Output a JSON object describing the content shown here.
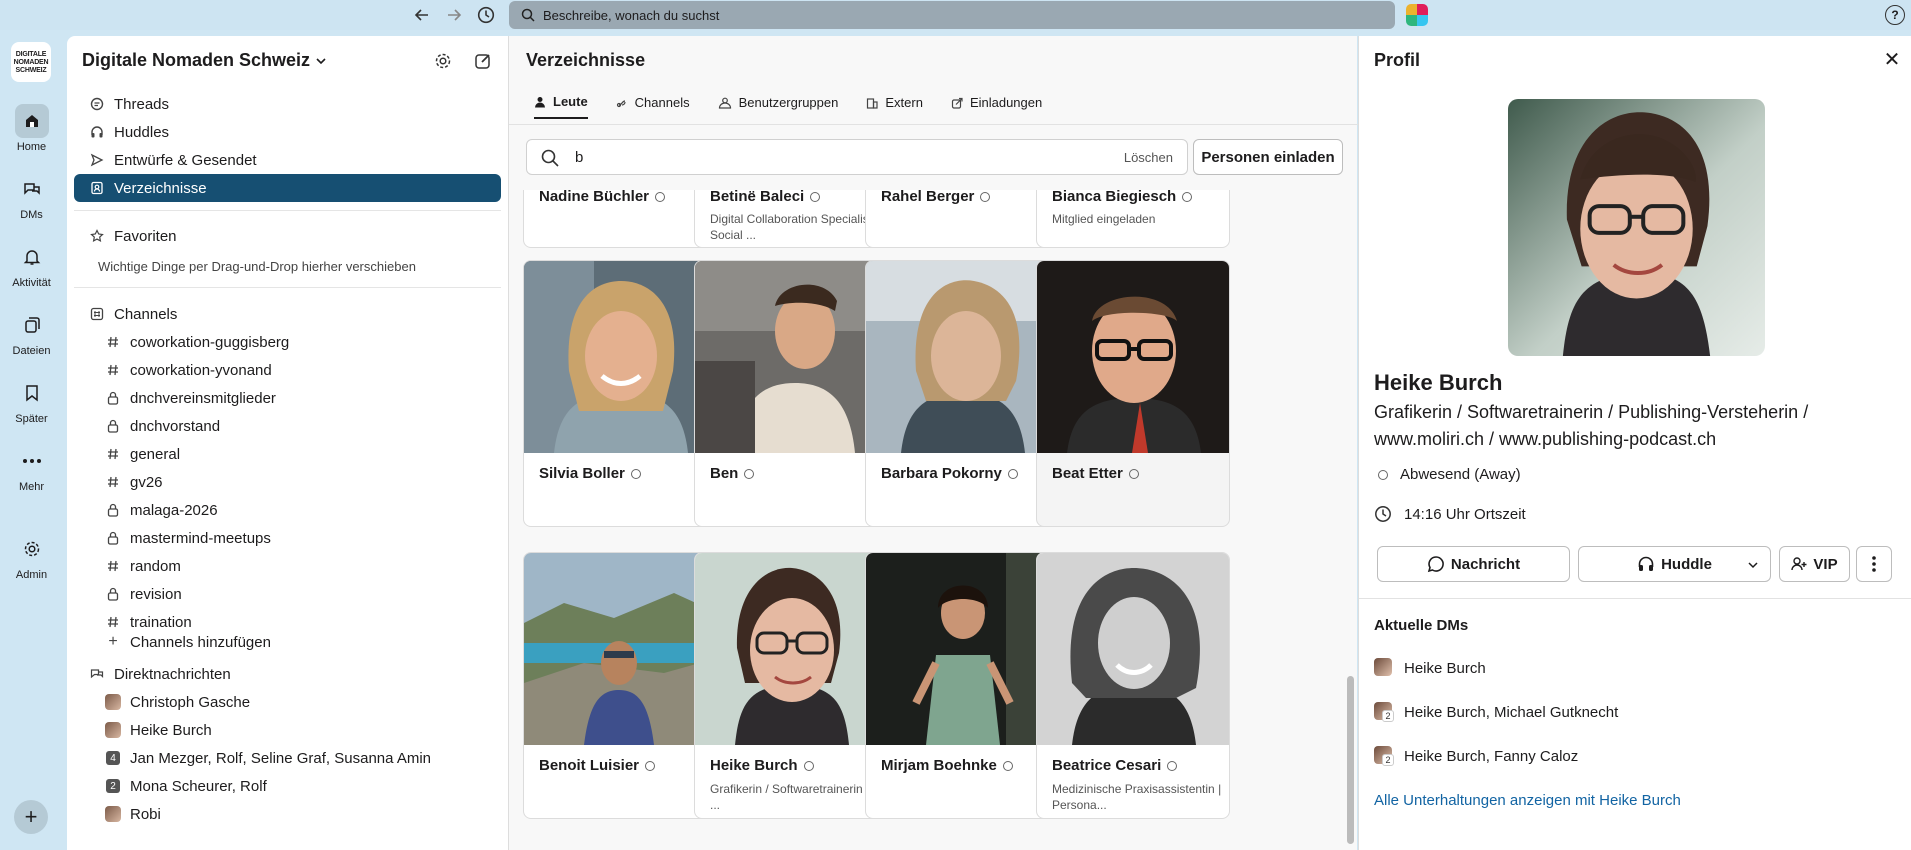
{
  "topbar": {
    "search_placeholder": "Beschreibe, wonach du suchst",
    "help": "?"
  },
  "rail": {
    "logo_lines": [
      "DIGITALE",
      "NOMADEN",
      "SCHWEIZ"
    ],
    "items": [
      {
        "label": "Home",
        "icon": "home-icon"
      },
      {
        "label": "DMs",
        "icon": "dms-icon"
      },
      {
        "label": "Aktivität",
        "icon": "bell-icon"
      },
      {
        "label": "Dateien",
        "icon": "files-icon"
      },
      {
        "label": "Später",
        "icon": "bookmark-icon"
      },
      {
        "label": "Mehr",
        "icon": "more-icon"
      },
      {
        "label": "Admin",
        "icon": "gear-icon"
      }
    ],
    "add": "+"
  },
  "sidebar": {
    "workspace": "Digitale Nomaden Schweiz",
    "nav": [
      {
        "label": "Threads",
        "icon": "threads-icon"
      },
      {
        "label": "Huddles",
        "icon": "headphones-icon"
      },
      {
        "label": "Entwürfe & Gesendet",
        "icon": "send-icon"
      },
      {
        "label": "Verzeichnisse",
        "icon": "directory-icon"
      }
    ],
    "favorites": {
      "label": "Favoriten",
      "hint": "Wichtige Dinge per Drag-und-Drop hierher verschieben"
    },
    "channels_label": "Channels",
    "channels": [
      {
        "name": "coworkation-guggisberg",
        "private": false
      },
      {
        "name": "coworkation-yvonand",
        "private": false
      },
      {
        "name": "dnchvereinsmitglieder",
        "private": true
      },
      {
        "name": "dnchvorstand",
        "private": true
      },
      {
        "name": "general",
        "private": false
      },
      {
        "name": "gv26",
        "private": false
      },
      {
        "name": "malaga-2026",
        "private": true
      },
      {
        "name": "mastermind-meetups",
        "private": true
      },
      {
        "name": "random",
        "private": false
      },
      {
        "name": "revision",
        "private": true
      },
      {
        "name": "traination",
        "private": false
      }
    ],
    "add_channel": "Channels hinzufügen",
    "dm_label": "Direktnachrichten",
    "dms": [
      {
        "name": "Christoph Gasche",
        "badge": ""
      },
      {
        "name": "Heike Burch",
        "badge": ""
      },
      {
        "name": "Jan Mezger, Rolf, Seline Graf, Susanna Amin",
        "badge": "4"
      },
      {
        "name": "Mona Scheurer, Rolf",
        "badge": "2"
      },
      {
        "name": "Robi",
        "badge": ""
      }
    ]
  },
  "main": {
    "title": "Verzeichnisse",
    "tabs": [
      {
        "label": "Leute",
        "icon": "person-icon"
      },
      {
        "label": "Channels",
        "icon": "channels-icon"
      },
      {
        "label": "Benutzergruppen",
        "icon": "group-icon"
      },
      {
        "label": "Extern",
        "icon": "building-icon"
      },
      {
        "label": "Einladungen",
        "icon": "invite-icon"
      }
    ],
    "search_value": "b",
    "clear_label": "Löschen",
    "invite_label": "Personen einladen",
    "top_cards": [
      {
        "name": "Nadine Büchler",
        "sub": ""
      },
      {
        "name": "Betinë Baleci",
        "sub": "Digital Collaboration Specialist | Social ..."
      },
      {
        "name": "Rahel Berger",
        "sub": ""
      },
      {
        "name": "Bianca Biegiesch",
        "sub": "Mitglied eingeladen"
      }
    ],
    "cards": [
      {
        "name": "Silvia Boller",
        "sub": ""
      },
      {
        "name": "Ben",
        "sub": ""
      },
      {
        "name": "Barbara Pokorny",
        "sub": ""
      },
      {
        "name": "Beat Etter",
        "sub": ""
      },
      {
        "name": "Benoit Luisier",
        "sub": ""
      },
      {
        "name": "Heike Burch",
        "sub": "Grafikerin / Softwaretrainerin / ..."
      },
      {
        "name": "Mirjam Boehnke",
        "sub": ""
      },
      {
        "name": "Beatrice Cesari",
        "sub": "Medizinische Praxisassistentin | Persona..."
      }
    ]
  },
  "profile": {
    "title": "Profil",
    "close": "✕",
    "name": "Heike Burch",
    "role": "Grafikerin / Softwaretrainerin / Publishing-Versteherin / www.moliri.ch / www.publishing-podcast.ch",
    "status": "Abwesend (Away)",
    "local_time": "14:16 Uhr Ortszeit",
    "buttons": {
      "message": "Nachricht",
      "huddle": "Huddle",
      "vip": "VIP"
    },
    "recent_dms_label": "Aktuelle DMs",
    "recent_dms": [
      {
        "label": "Heike Burch",
        "count": ""
      },
      {
        "label": "Heike Burch, Michael Gutknecht",
        "count": "2"
      },
      {
        "label": "Heike Burch, Fanny Caloz",
        "count": "2"
      }
    ],
    "all_link": "Alle Unterhaltungen anzeigen mit Heike Burch"
  }
}
